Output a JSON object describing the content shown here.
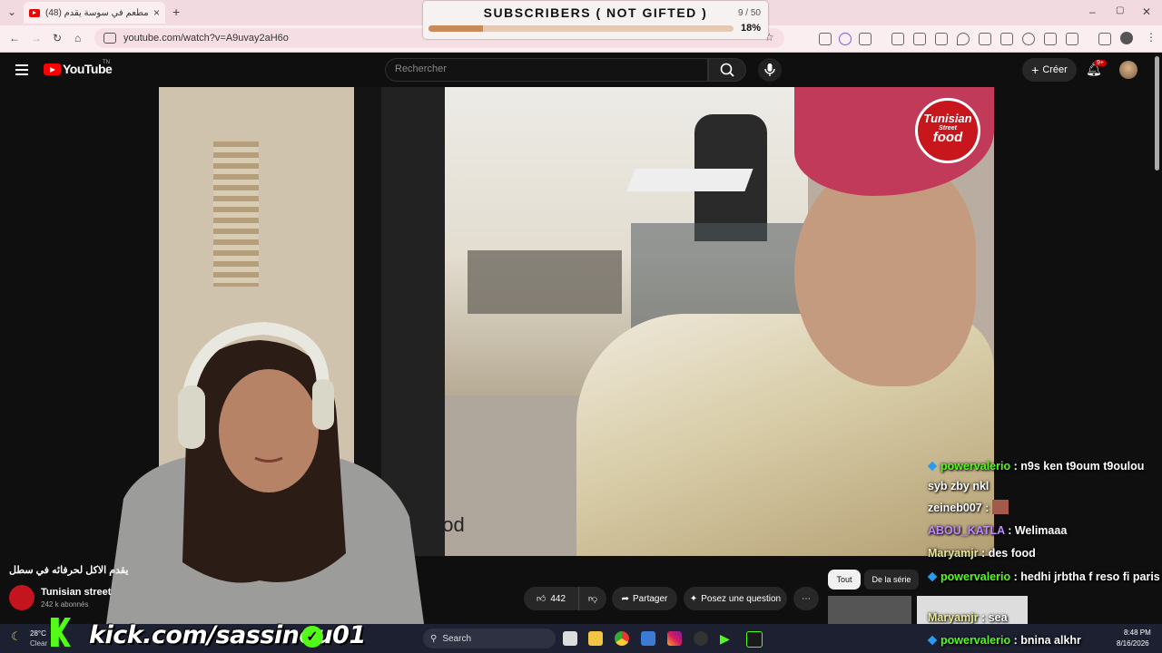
{
  "browser": {
    "tab_title": "(48) مطعم في سوسة يقدم",
    "tab_close": "×",
    "new_tab": "+",
    "url": "youtube.com/watch?v=A9uvay2aH6o",
    "window_controls": [
      "–",
      "▢",
      "✕"
    ]
  },
  "overlay": {
    "subscribers_label": "SUBSCRIBERS ( NOT GIFTED )",
    "count": "9 / 50",
    "percent": "18%",
    "progress": 0.18
  },
  "youtube": {
    "logo_text": "YouTube",
    "logo_tm": "TN",
    "search_placeholder": "Rechercher",
    "create_label": "Créer",
    "notif_count": "9+"
  },
  "video": {
    "brand_line1": "Tunisian",
    "brand_line2": "Street",
    "brand_line3": "food",
    "caption_fragment": "ood"
  },
  "below": {
    "title": "يقدم الاكل لحرفائه في سطل",
    "channel_name": "Tunisian street",
    "channel_subs": "242 k abonnés",
    "likes": "442",
    "share_label": "Partager",
    "ask_label": "Posez une question",
    "chips": [
      "Tout",
      "De la série"
    ]
  },
  "chat": [
    {
      "user": "powervalerio",
      "msg": ": n9s ken t9oum t9oulou syb zby nkl",
      "color": "green"
    },
    {
      "user": "zeineb007",
      "msg": ":",
      "color": "white"
    },
    {
      "user": "ABOU_KATLA",
      "msg": ": Welimaaa",
      "color": "purple"
    },
    {
      "user": "Maryamjr",
      "msg": ": des food",
      "color": "yellow"
    },
    {
      "user": "powervalerio",
      "msg": ": hedhi jrbtha f reso fi paris",
      "color": "green"
    },
    {
      "user": "Maryamjr",
      "msg": ": sea",
      "color": "yellow"
    },
    {
      "user": "powervalerio",
      "msg": ": bnina alkhr",
      "color": "green"
    }
  ],
  "stream": {
    "kick_handle": "kick.com/sassinou01",
    "weather_temp": "28°C",
    "weather_desc": "Clear",
    "taskbar_search": "Search",
    "time": "8:48 PM",
    "date": "8/16/2026"
  }
}
